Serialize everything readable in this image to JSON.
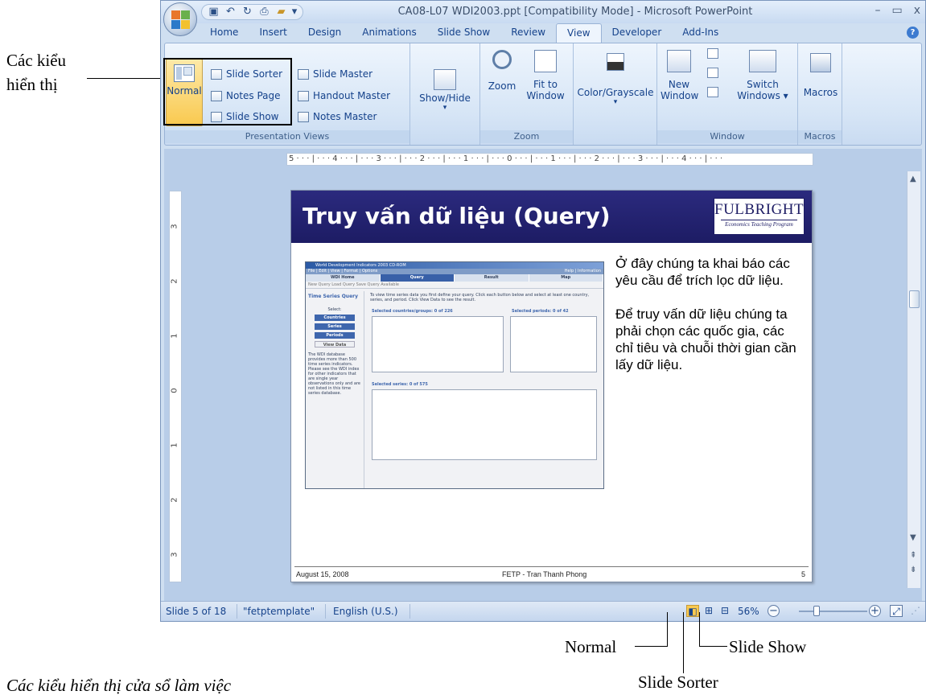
{
  "window": {
    "title": "CA08-L07 WDI2003.ppt [Compatibility Mode] - Microsoft PowerPoint",
    "controls": [
      "–",
      "▭",
      "x"
    ]
  },
  "qat": [
    "save-icon",
    "undo-icon",
    "redo-icon",
    "print-preview-icon",
    "open-icon"
  ],
  "tabs": [
    "Home",
    "Insert",
    "Design",
    "Animations",
    "Slide Show",
    "Review",
    "View",
    "Developer",
    "Add-Ins"
  ],
  "active_tab": "View",
  "ribbon": {
    "presentation_views": {
      "label": "Presentation Views",
      "normal": "Normal",
      "slide_sorter": "Slide Sorter",
      "notes_page": "Notes Page",
      "slide_show": "Slide Show",
      "slide_master": "Slide Master",
      "handout_master": "Handout Master",
      "notes_master": "Notes Master"
    },
    "show_hide": "Show/Hide",
    "zoom": {
      "label": "Zoom",
      "zoom": "Zoom",
      "fit1": "Fit to",
      "fit2": "Window"
    },
    "color": "Color/Grayscale",
    "window": {
      "label": "Window",
      "new1": "New",
      "new2": "Window",
      "switch1": "Switch",
      "switch2": "Windows ▾"
    },
    "macros": {
      "label": "Macros",
      "macros": "Macros"
    }
  },
  "ruler": {
    "horizontal": "5 · · · | · · · 4 · · · | · · · 3 · · · | · · · 2 · · · | · · · 1 · · · | · · · 0 · · · | · · · 1 · · · | · · · 2 · · · | · · · 3 · · · | · · · 4 · · · | · · ·",
    "vertical": [
      "3",
      "2",
      "1",
      "0",
      "1",
      "2",
      "3"
    ]
  },
  "slide": {
    "title": "Truy vấn dữ liệu (Query)",
    "logo_name": "FULBRIGHT",
    "logo_sub": "Economics Teaching Program",
    "text1": "Ở đây chúng ta khai báo các yêu cầu để trích lọc dữ liệu.",
    "text2": "Để truy vấn dữ liệu chúng ta phải chọn các quốc gia, các chỉ tiêu và chuỗi thời gian cần lấy dữ liệu.",
    "footer_date": "August 15, 2008",
    "footer_author": "FETP - Tran Thanh Phong",
    "footer_page": "5"
  },
  "wdi": {
    "title": "World Development Indicators 2003 CD-ROM",
    "menu": "File | Edit | View | Format | Options",
    "menu_right": "Help | Information",
    "nav": [
      "WDI Home",
      "Query",
      "Result",
      "Map"
    ],
    "toolbar": "New Query   Load Query   Save Query   Available",
    "section": "Time Series Query",
    "instructions": "To view time series data you first define your query. Click each button below and select at least one country, series, and period. Click View Data to see the result.",
    "select": "Select:",
    "buttons": [
      "Countries",
      "Series",
      "Periods",
      "View Data"
    ],
    "note": "The WDI database provides more than 500 time series indicators. Please see the WDI index for other indicators that are single year observations only and are not listed in this time series database.",
    "sel_countries": "Selected countries/groups: 0 of 226",
    "sel_periods": "Selected periods: 0 of 42",
    "sel_series": "Selected series: 0 of 575"
  },
  "status": {
    "slide": "Slide 5 of 18",
    "template": "\"fetptemplate\"",
    "language": "English (U.S.)",
    "zoom": "56%",
    "zoom_level": 0.56
  },
  "annotations": {
    "views_label_1": "Các kiểu",
    "views_label_2": "hiển thị",
    "normal": "Normal",
    "slide_show": "Slide Show",
    "slide_sorter": "Slide Sorter",
    "caption": "Các kiểu hiển thị cửa sổ làm việc"
  },
  "colors": {
    "ribbon_tab_text": "#15428b",
    "slide_header": "#1d1c64",
    "normal_highlight": "#f9c94f"
  }
}
